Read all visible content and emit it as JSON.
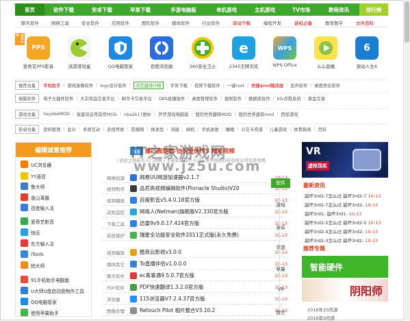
{
  "nav": {
    "items": [
      "首页",
      "软件下载",
      "安卓下载",
      "苹果下载",
      "手游电脑版",
      "单机游戏",
      "主机游戏",
      "TV市场",
      "教程资讯"
    ],
    "rank": "排行榜"
  },
  "subnav": [
    "聊天软件",
    "网络工具",
    "安全软件",
    "应用软件",
    "图形软件",
    "媒体软件",
    "行业软件",
    "驱动下载",
    "编程开发",
    "装机必备",
    "教育教学",
    "文件百科"
  ],
  "ribbon": "装机必备",
  "apps": [
    {
      "name": "爱奇艺PPS影音",
      "logo": "PPS"
    },
    {
      "name": "逃游游戏盒",
      "logo": ""
    },
    {
      "name": "QQ电脑管家",
      "logo": ""
    },
    {
      "name": "百度浏览器",
      "logo": ""
    },
    {
      "name": "360安全卫士",
      "logo": "+"
    },
    {
      "name": "2345王牌浏览",
      "logo": "e"
    },
    {
      "name": "WPS Office",
      "logo": "WPS"
    },
    {
      "name": "么么直播",
      "logo": ""
    },
    {
      "name": "驱动人生6",
      "logo": "6"
    }
  ],
  "tagrows": [
    {
      "label": "推荐合集",
      "items": [
        {
          "t": "手机助手",
          "c": "red"
        },
        {
          "t": "游戏录像软件"
        },
        {
          "t": "logo设计软件"
        },
        {
          "t": "浏览器排行榜",
          "c": "grn"
        },
        {
          "t": "字体下载"
        },
        {
          "t": "视频下载软件"
        },
        {
          "t": "一键root"
        },
        {
          "t": "快播qvod播放器",
          "c": "red"
        },
        {
          "t": "变声软件"
        },
        {
          "t": "桌面美化软件"
        }
      ]
    },
    {
      "label": "电脑软件",
      "items": [
        {
          "t": "电子元器件软件"
        },
        {
          "t": "大宗商品交易平台"
        },
        {
          "t": "邮币卡交易平台"
        },
        {
          "t": "OBS直播插件"
        },
        {
          "t": "桌面管理软件"
        },
        {
          "t": "报税软件"
        },
        {
          "t": "数据库软件"
        },
        {
          "t": "ktv点歌系统"
        },
        {
          "t": "黄金交易"
        }
      ]
    },
    {
      "label": "游戏合集",
      "items": [
        {
          "t": "haydeeMOD"
        },
        {
          "t": "侠客风云传前传MOD"
        },
        {
          "t": "nba2k17图补"
        },
        {
          "t": "开罗游戏电脑版"
        },
        {
          "t": "我的世界趣味MOD"
        },
        {
          "t": "我的世界建筑mod"
        },
        {
          "t": "西部游戏"
        }
      ]
    },
    {
      "label": "安卓合集",
      "items": [
        {
          "t": "密码管理"
        },
        {
          "t": "会计"
        },
        {
          "t": "多屏互动"
        },
        {
          "t": "无线传屏"
        },
        {
          "t": "防蹭网"
        },
        {
          "t": "换发型"
        },
        {
          "t": "测速"
        },
        {
          "t": "刷机"
        },
        {
          "t": "手机收款"
        },
        {
          "t": "睡眠"
        },
        {
          "t": "公交卡充值"
        },
        {
          "t": "儿童游戏"
        },
        {
          "t": "体育新闻"
        },
        {
          "t": "百科"
        }
      ]
    }
  ],
  "left": {
    "title": "编辑诚意推荐",
    "items": [
      "UC浏览器",
      "YY语音",
      "鲁大师",
      "金山毒霸",
      "百度输入法",
      "爱奇艺影音",
      "快压",
      "东方输入法",
      "iTools",
      "拍大师",
      "91手机助手电脑版",
      "U大师U盘启动盘制作工具",
      "QQ电脑管家",
      "使用苹果助手"
    ]
  },
  "center": {
    "promo_tag": "独家",
    "promo_text": "爆四面楚歌 仙剑奇侠传3 精彩视频",
    "sub": "| 流放之路新手入门攻略 | 王者荣耀新手入门 | 快手网络科技有限公司完美攻略",
    "rows": [
      {
        "cat": "网络加速",
        "name": "网易UU网游加速器v2.1.7",
        "date": "10-13"
      },
      {
        "cat": "视频制作",
        "name": "品尼高视频编辑软件(Pinnacle Studio)V20",
        "date": "10-13"
      },
      {
        "cat": "视频播放",
        "name": "百度影音v5.4.0.18官方版",
        "date": "10-13"
      },
      {
        "cat": "远程监控",
        "name": "网络人(Netman)旗舰版V2.330官方版",
        "date": "10-13"
      },
      {
        "cat": "下载工具",
        "name": "迅雷9v9.0.17.424官方版",
        "date": "10-13"
      },
      {
        "cat": "系统保护",
        "name": "瑞星全功能安全软件2011正式版(永久免费)",
        "date": "10-13"
      },
      {
        "cat": "视频播放",
        "name": "酷菲云影视v3.0.0",
        "date": "10-13"
      },
      {
        "cat": "媒体其它",
        "name": "To直播伴侣v1.0.0.0",
        "date": "10-13"
      },
      {
        "cat": "聊天软件",
        "name": "ec客客通9.5.0.7官方版",
        "date": "10-13"
      },
      {
        "cat": "PDF软件",
        "name": "PDF快速翻译1.3.2.0官方版",
        "date": "10-13"
      },
      {
        "cat": "浏览器",
        "name": "115浏览器V7.2.4.37官方版",
        "date": "10-13"
      },
      {
        "cat": "图像处理",
        "name": "Retouch Pilot 相片整合V3.10.2",
        "date": "10-13"
      }
    ],
    "cats": [
      "软件",
      "游戏",
      "安卓",
      "手游",
      "苹果",
      "VR",
      "其它"
    ],
    "watermark1": "IT之家游戏网",
    "watermark2": "www.jz5u.com"
  },
  "right": {
    "banner_big": "VR",
    "banner_sub": "虚拟现实",
    "news_title": "最新资讯",
    "news": [
      {
        "t": "崩坏3rd2-7怎么过 崩坏3rd2-7",
        "d": "10-13"
      },
      {
        "t": "崩坏3rd2-7怎么过 崩坏3rd2-",
        "d": "10-13"
      },
      {
        "t": "崩坏3rd1- 崩坏3rd1-",
        "d": "10-13"
      },
      {
        "t": "崩坏3rd2-5怎么过 崩坏3rd2-5",
        "d": "10-13"
      },
      {
        "t": "崩坏3rd2-4怎么过 崩坏3rd2-",
        "d": "10-13"
      },
      {
        "t": "崩坏3rd2-3怎么过 崩坏3rd2-",
        "d": "10-13"
      }
    ],
    "topic_title": "推荐专题",
    "hw": "智能硬件",
    "game": "阴阳师",
    "foot1": "2016年10月游",
    "foot2": "2016年9月游"
  }
}
